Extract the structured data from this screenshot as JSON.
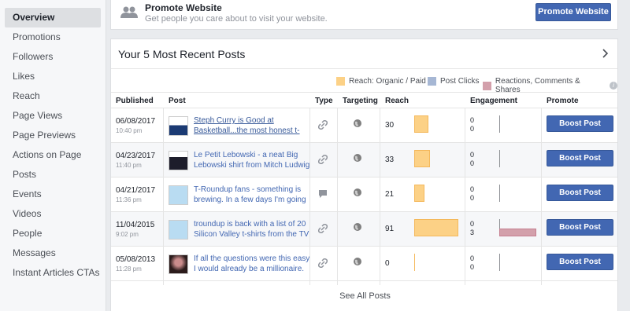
{
  "sidebar": {
    "items": [
      {
        "label": "Overview"
      },
      {
        "label": "Promotions"
      },
      {
        "label": "Followers"
      },
      {
        "label": "Likes"
      },
      {
        "label": "Reach"
      },
      {
        "label": "Page Views"
      },
      {
        "label": "Page Previews"
      },
      {
        "label": "Actions on Page"
      },
      {
        "label": "Posts"
      },
      {
        "label": "Events"
      },
      {
        "label": "Videos"
      },
      {
        "label": "People"
      },
      {
        "label": "Messages"
      },
      {
        "label": "Instant Articles CTAs"
      }
    ]
  },
  "promo": {
    "title": "Promote Website",
    "subtitle": "Get people you care about to visit your website.",
    "button": "Promote Website"
  },
  "posts": {
    "title": "Your 5 Most Recent Posts",
    "legend": {
      "reach": "Reach: Organic / Paid",
      "clicks": "Post Clicks",
      "reactions": "Reactions, Comments & Shares"
    },
    "columns": {
      "published": "Published",
      "post": "Post",
      "type": "Type",
      "targeting": "Targeting",
      "reach": "Reach",
      "engagement": "Engagement",
      "promote": "Promote"
    },
    "rows": [
      {
        "date": "06/08/2017",
        "time": "10:40 pm",
        "text": "Steph Curry is Good at Basketball...the most honest t-",
        "type": "link-icon",
        "reach": "30",
        "eng_clicks": "0",
        "eng_reactions": "0",
        "boost": "Boost Post"
      },
      {
        "date": "04/23/2017",
        "time": "11:40 pm",
        "text": "Le Petit Lebowski - a neat Big Lebowski shirt from Mitch Ludwig",
        "type": "link-icon",
        "reach": "33",
        "eng_clicks": "0",
        "eng_reactions": "0",
        "boost": "Boost Post"
      },
      {
        "date": "04/21/2017",
        "time": "11:36 pm",
        "text": "T-Roundup fans - something is brewing. In a few days I'm going",
        "type": "status-icon",
        "reach": "21",
        "eng_clicks": "0",
        "eng_reactions": "0",
        "boost": "Boost Post"
      },
      {
        "date": "11/04/2015",
        "time": "9:02 pm",
        "text": "troundup is back with a list of 20 Silicon Valley t-shirts from the TV",
        "type": "link-icon",
        "reach": "91",
        "eng_clicks": "0",
        "eng_reactions": "3",
        "boost": "Boost Post"
      },
      {
        "date": "05/08/2013",
        "time": "11:28 pm",
        "text": "If all the questions were this easy I would already be a millionaire.",
        "type": "link-icon",
        "reach": "0",
        "eng_clicks": "0",
        "eng_reactions": "0",
        "boost": "Boost Post"
      }
    ],
    "see_all": "See All Posts"
  },
  "colors": {
    "accent": "#4267b2",
    "reach": "#fcd186",
    "clicks": "#a6b7d4",
    "reactions": "#d3a0ab"
  }
}
